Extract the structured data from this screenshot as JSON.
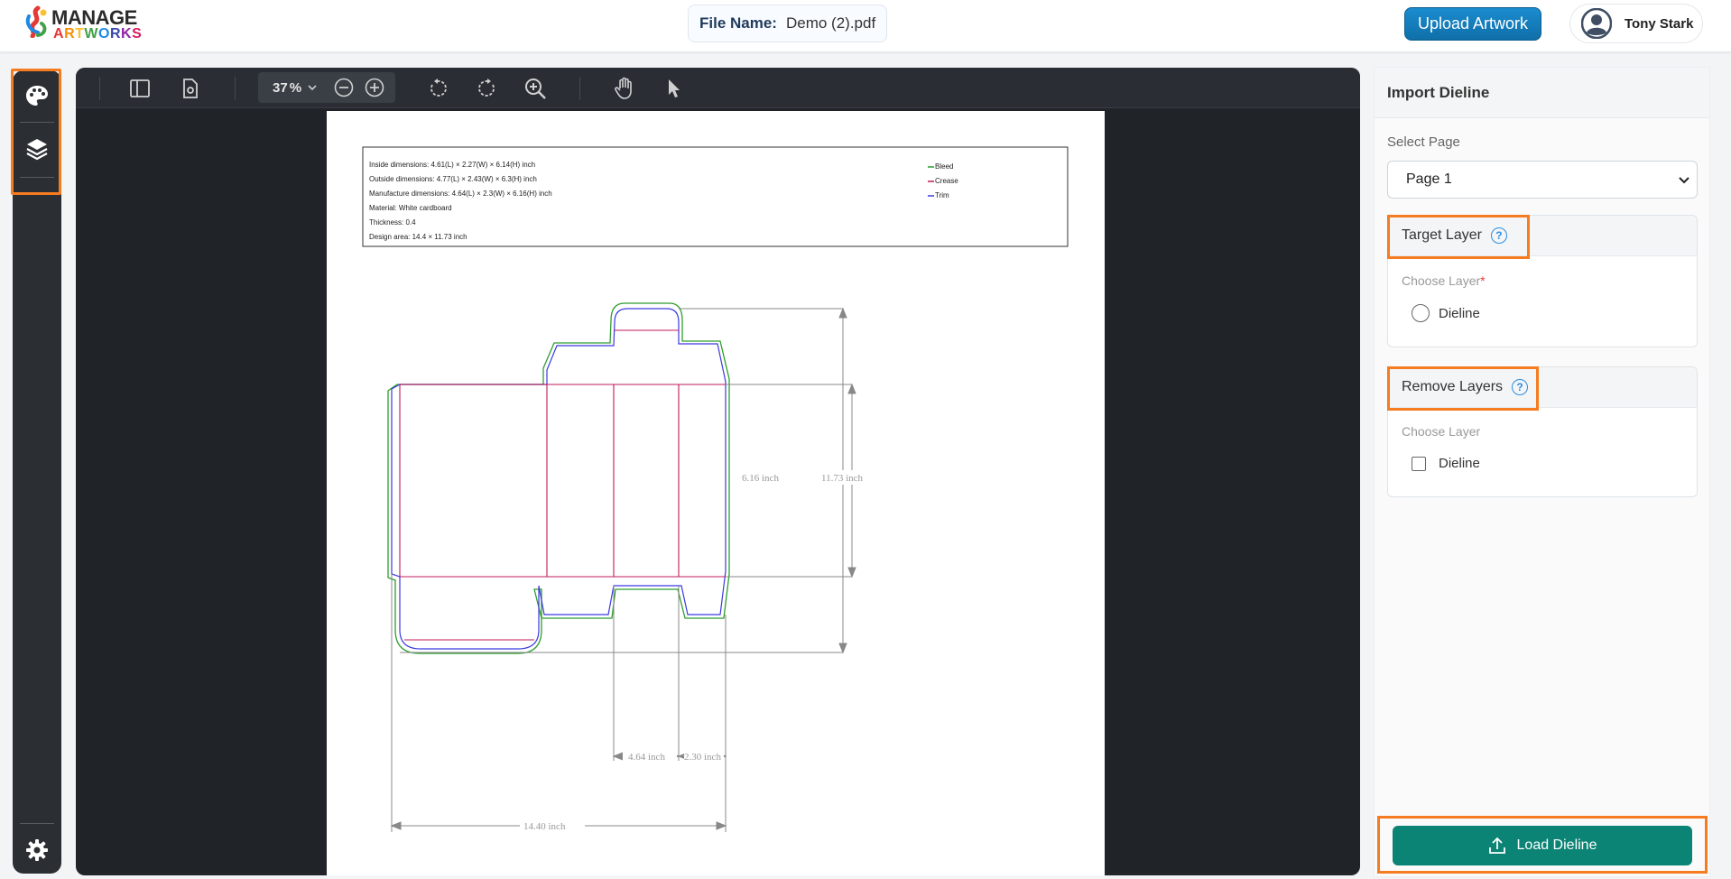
{
  "header": {
    "logo_line1": "MANAGE",
    "logo_line2": "ARTWORKS",
    "file_name_label": "File Name:",
    "file_name_value": "Demo (2).pdf",
    "upload_label": "Upload Artwork",
    "user_name": "Tony Stark"
  },
  "rail": {
    "icons": [
      "palette-icon",
      "layers-icon",
      "settings-icon"
    ]
  },
  "toolbar": {
    "zoom_value": "37",
    "zoom_unit": "%",
    "icons": [
      "sidebar-toggle-icon",
      "document-properties-icon",
      "chevron-down-icon",
      "zoom-out-icon",
      "zoom-in-icon",
      "rotate-ccw-icon",
      "rotate-cw-icon",
      "magnify-icon",
      "pan-hand-icon",
      "select-pointer-icon"
    ]
  },
  "dieline": {
    "info_lines": [
      "Inside dimensions: 4.61(L) × 2.27(W) × 6.14(H) inch",
      "Outside dimensions: 4.77(L) × 2.43(W) × 6.3(H) inch",
      "Manufacture dimensions: 4.64(L) × 2.3(W) × 6.16(H) inch",
      "Material: White cardboard",
      "Thickness: 0.4",
      "Design area: 14.4 × 11.73 inch"
    ],
    "legend": [
      {
        "label": "Bleed",
        "color": "#2e9e2e"
      },
      {
        "label": "Crease",
        "color": "#c2185b"
      },
      {
        "label": "Trim",
        "color": "#3a3ae0"
      }
    ],
    "dimensions": {
      "height_inner": "6.16 inch",
      "height_total": "11.73 inch",
      "length": "4.64 inch",
      "width": "2.30 inch",
      "total_width": "14.40 inch"
    }
  },
  "panel": {
    "title": "Import Dieline",
    "select_page_label": "Select Page",
    "select_page_value": "Page 1",
    "target_layer_title": "Target Layer",
    "target_choose_label": "Choose Layer",
    "target_required": "*",
    "target_option": "Dieline",
    "remove_layers_title": "Remove Layers",
    "remove_choose_label": "Choose Layer",
    "remove_option": "Dieline",
    "help_glyph": "?",
    "load_button": "Load Dieline"
  },
  "colors": {
    "accent_highlight": "#f57c20",
    "primary_button": "#0b8476",
    "upload_button": "#1a8ccf"
  }
}
